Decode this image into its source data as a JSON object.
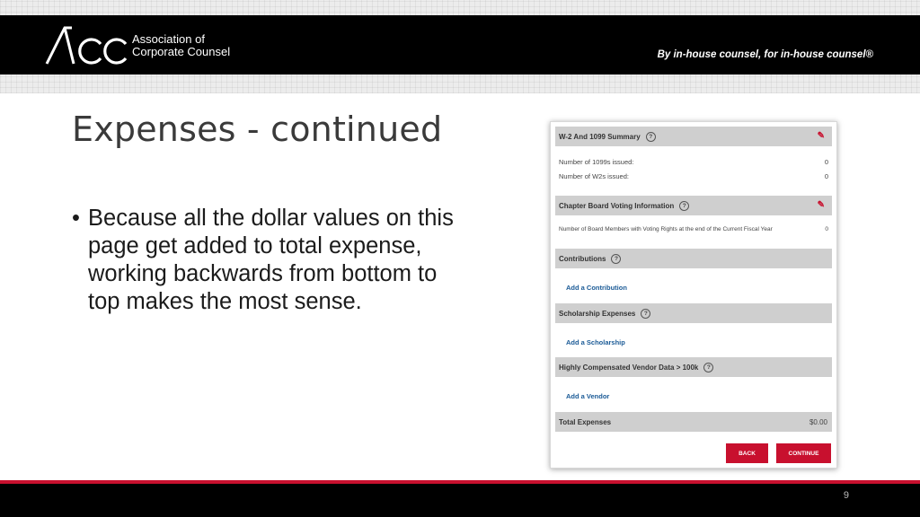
{
  "header": {
    "logo_letters": "ACC",
    "logo_line1": "Association of",
    "logo_line2": "Corporate Counsel",
    "tagline": "By in-house counsel, for in-house counsel®"
  },
  "slide": {
    "title": "Expenses - continued",
    "bullet_marker": "•",
    "bullet_text": "Because all the dollar values on this page get added to total expense, working backwards from bottom to top makes the most sense.",
    "page_number": "9"
  },
  "panel": {
    "w2_section": {
      "title": "W-2 And 1099 Summary",
      "rows": [
        {
          "label": "Number of 1099s issued:",
          "value": "0"
        },
        {
          "label": "Number of W2s issued:",
          "value": "0"
        }
      ]
    },
    "voting_section": {
      "title": "Chapter Board Voting Information",
      "rows": [
        {
          "label": "Number of Board Members with Voting Rights at the end of the Current Fiscal Year",
          "value": "0"
        }
      ]
    },
    "contributions_section": {
      "title": "Contributions",
      "link": "Add a Contribution"
    },
    "scholarship_section": {
      "title": "Scholarship Expenses",
      "link": "Add a Scholarship"
    },
    "vendor_section": {
      "title": "Highly Compensated Vendor Data > 100k",
      "link": "Add a Vendor"
    },
    "total": {
      "label": "Total Expenses",
      "amount": "$0.00"
    },
    "buttons": {
      "back": "BACK",
      "continue": "CONTINUE"
    },
    "icons": {
      "help": "question-circle-icon",
      "edit": "pencil-icon"
    },
    "colors": {
      "accent": "#c8102e",
      "link": "#1a5a96",
      "section_bg": "#cfcfcf"
    }
  }
}
